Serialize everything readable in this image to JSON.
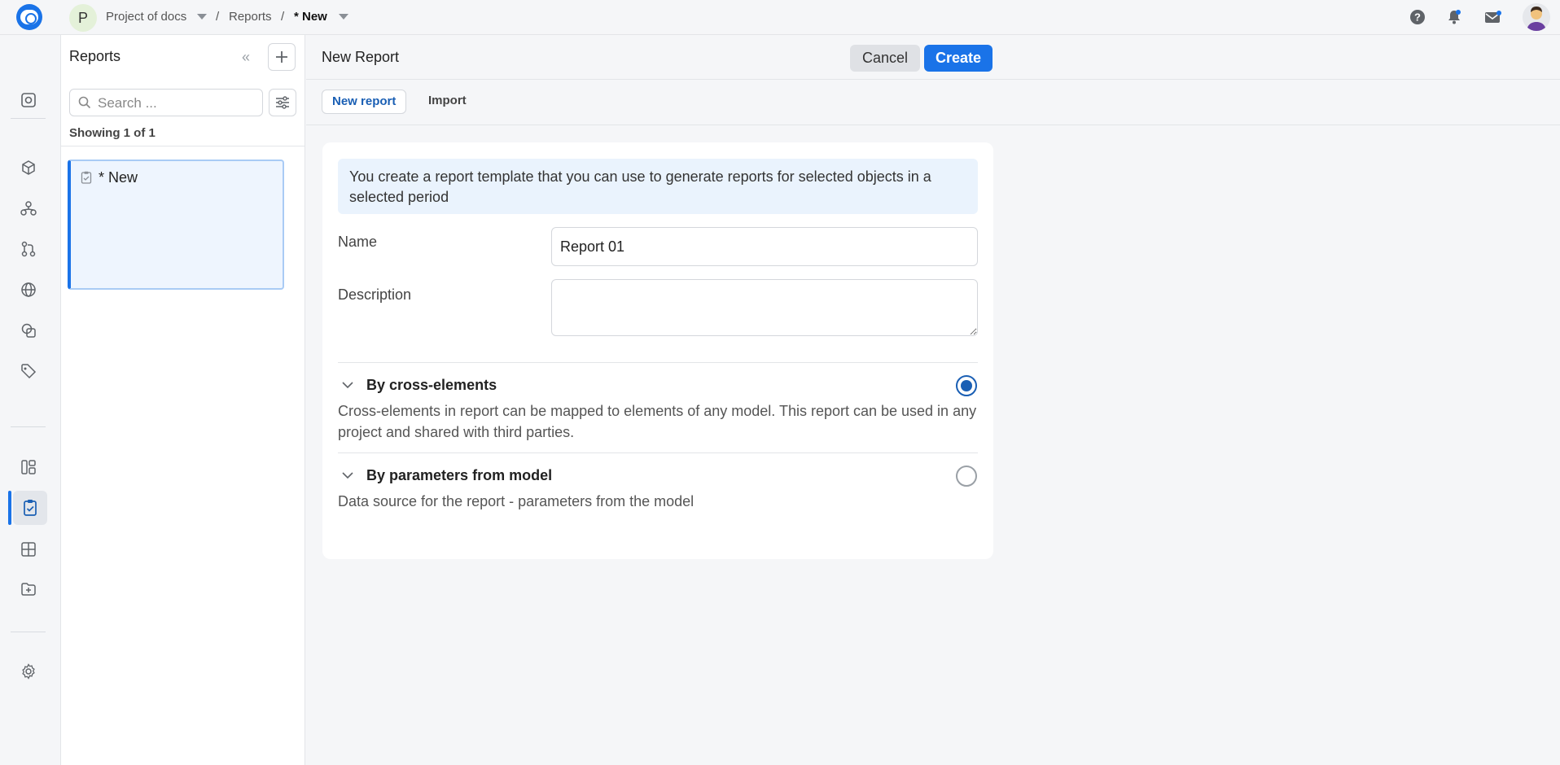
{
  "topbar": {
    "project_initial": "P",
    "project_name": "Project of docs",
    "separator1": "/",
    "section": "Reports",
    "separator2": "/",
    "current": "* New",
    "icons": [
      "help-icon",
      "bell-icon",
      "mail-icon",
      "user-avatar"
    ]
  },
  "rail": {
    "items": [
      "home-icon",
      "cube-icon",
      "hierarchy-icon",
      "branch-icon",
      "globe-icon",
      "shapes-icon",
      "tag-icon",
      "dashboard-icon",
      "reports-icon",
      "grid-icon",
      "folder-add-icon",
      "settings-icon"
    ],
    "active": "reports-icon"
  },
  "panel": {
    "title": "Reports",
    "search_placeholder": "Search ...",
    "showing": "Showing 1 of 1",
    "items": [
      {
        "title": "* New"
      }
    ]
  },
  "main": {
    "title": "New Report",
    "cancel_label": "Cancel",
    "create_label": "Create",
    "tabs": [
      {
        "label": "New report",
        "active": true
      },
      {
        "label": "Import",
        "active": false
      }
    ]
  },
  "form": {
    "info": "You create a report template that you can use to generate reports for selected objects in a selected period",
    "name_label": "Name",
    "name_value": "Report 01",
    "description_label": "Description",
    "description_value": "",
    "options": [
      {
        "title": "By cross-elements",
        "description": "Cross-elements in report can be mapped to elements of any model. This report can be used in any project and shared with third parties.",
        "selected": true
      },
      {
        "title": "By parameters from model",
        "description": "Data source for the report - parameters from the model",
        "selected": false
      }
    ]
  },
  "colors": {
    "accent": "#1a73e8",
    "selected_radio": "#1a5fb4",
    "info_bg": "#eaf3fd"
  }
}
